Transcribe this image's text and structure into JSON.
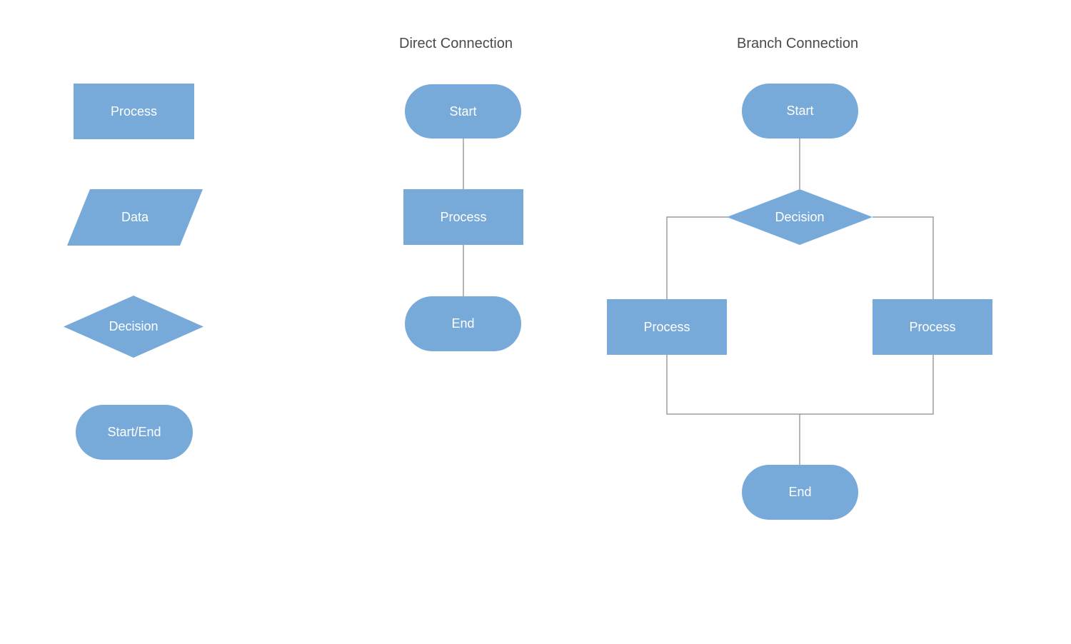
{
  "titles": {
    "direct": "Direct Connection",
    "branch": "Branch Connection"
  },
  "legend": {
    "process": "Process",
    "data": "Data",
    "decision": "Decision",
    "terminator": "Start/End"
  },
  "direct": {
    "start": "Start",
    "process": "Process",
    "end": "End"
  },
  "branch": {
    "start": "Start",
    "decision": "Decision",
    "processLeft": "Process",
    "processRight": "Process",
    "end": "End"
  },
  "colors": {
    "shape": "#77aad9",
    "title": "#4a4a4a",
    "connector": "#9e9e9e"
  }
}
